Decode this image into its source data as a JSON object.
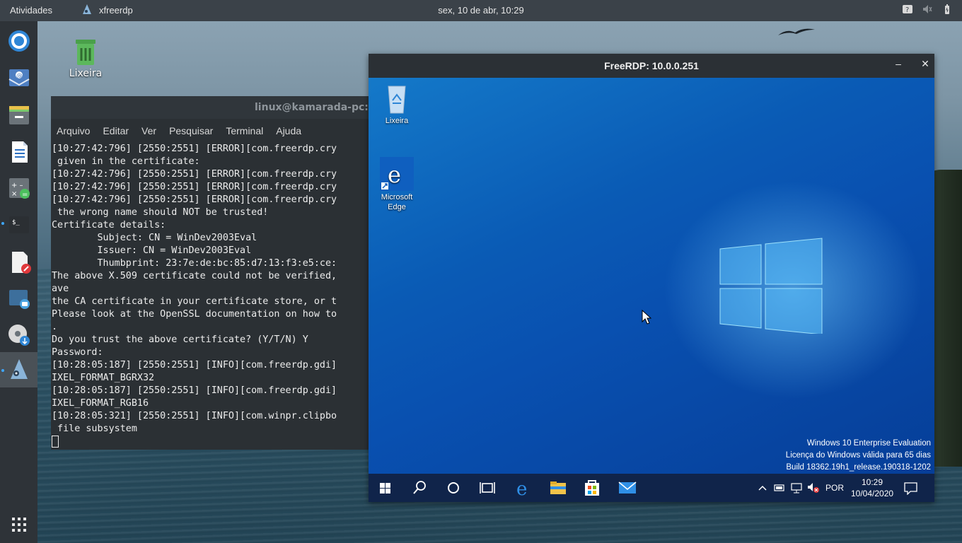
{
  "topbar": {
    "activities": "Atividades",
    "app_name": "xfreerdp",
    "clock": "sex, 10 de abr, 10:29"
  },
  "desktop": {
    "trash_label": "Lixeira"
  },
  "terminal": {
    "title": "linux@kamarada-pc:~",
    "menu": [
      "Arquivo",
      "Editar",
      "Ver",
      "Pesquisar",
      "Terminal",
      "Ajuda"
    ],
    "lines": [
      "[10:27:42:796] [2550:2551] [ERROR][com.freerdp.cry",
      " given in the certificate:",
      "[10:27:42:796] [2550:2551] [ERROR][com.freerdp.cry",
      "[10:27:42:796] [2550:2551] [ERROR][com.freerdp.cry",
      "[10:27:42:796] [2550:2551] [ERROR][com.freerdp.cry",
      " the wrong name should NOT be trusted!",
      "Certificate details:",
      "        Subject: CN = WinDev2003Eval",
      "        Issuer: CN = WinDev2003Eval",
      "        Thumbprint: 23:7e:de:bc:85:d7:13:f3:e5:ce:",
      "The above X.509 certificate could not be verified,",
      "ave",
      "the CA certificate in your certificate store, or t",
      "Please look at the OpenSSL documentation on how to",
      ".",
      "Do you trust the above certificate? (Y/T/N) Y",
      "Password:",
      "[10:28:05:187] [2550:2551] [INFO][com.freerdp.gdi]",
      "IXEL_FORMAT_BGRX32",
      "[10:28:05:187] [2550:2551] [INFO][com.freerdp.gdi]",
      "IXEL_FORMAT_RGB16",
      "[10:28:05:321] [2550:2551] [INFO][com.winpr.clipbo",
      " file subsystem"
    ]
  },
  "rdp": {
    "title": "FreeRDP: 10.0.0.251",
    "minimize": "–",
    "close": "✕",
    "icons": {
      "recycle_bin": "Lixeira",
      "edge_line1": "Microsoft",
      "edge_line2": "Edge"
    },
    "watermark": {
      "line1": "Windows 10 Enterprise Evaluation",
      "line2": "Licença do Windows válida para 65 dias",
      "line3": "Build 18362.19h1_release.190318-1202"
    },
    "taskbar": {
      "language": "POR",
      "time": "10:29",
      "date": "10/04/2020"
    }
  },
  "colors": {
    "win_blue": "#0a5bb5",
    "taskbar": "#10244a",
    "terminal_bg": "#2b3034",
    "dock_bg": "#2e3338"
  }
}
